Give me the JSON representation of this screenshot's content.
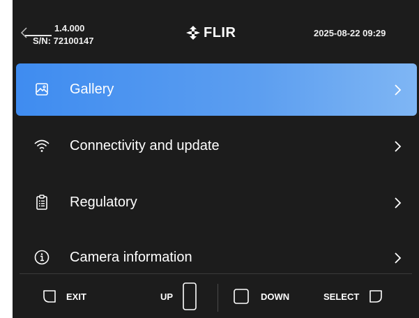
{
  "header": {
    "version": "1.4.000",
    "serial": "S/N: 72100147",
    "logo_text": "FLIR",
    "datetime": "2025-08-22 09:29"
  },
  "menu": {
    "items": [
      {
        "label": "Gallery",
        "icon": "gallery-icon",
        "selected": true
      },
      {
        "label": "Connectivity and update",
        "icon": "wifi-icon",
        "selected": false
      },
      {
        "label": "Regulatory",
        "icon": "clipboard-icon",
        "selected": false
      },
      {
        "label": "Camera information",
        "icon": "info-icon",
        "selected": false
      }
    ]
  },
  "buttons": {
    "exit": "EXIT",
    "up": "UP",
    "down": "DOWN",
    "select": "SELECT"
  },
  "colors": {
    "background": "#1c1c1c",
    "selected_start": "#3f8cf0",
    "selected_end": "#7fb6f4",
    "text": "#ffffff"
  }
}
